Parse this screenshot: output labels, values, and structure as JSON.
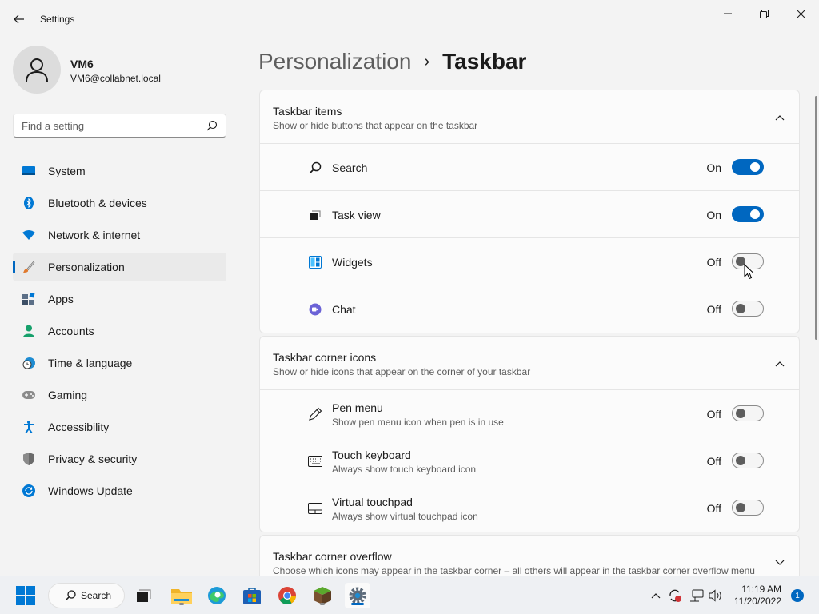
{
  "window": {
    "title": "Settings"
  },
  "profile": {
    "name": "VM6",
    "email": "VM6@collabnet.local"
  },
  "search": {
    "placeholder": "Find a setting"
  },
  "sidebar": {
    "items": [
      {
        "label": "System",
        "icon": "system-icon",
        "active": false
      },
      {
        "label": "Bluetooth & devices",
        "icon": "bluetooth-icon",
        "active": false
      },
      {
        "label": "Network & internet",
        "icon": "wifi-icon",
        "active": false
      },
      {
        "label": "Personalization",
        "icon": "brush-icon",
        "active": true
      },
      {
        "label": "Apps",
        "icon": "apps-icon",
        "active": false
      },
      {
        "label": "Accounts",
        "icon": "accounts-icon",
        "active": false
      },
      {
        "label": "Time & language",
        "icon": "clock-globe-icon",
        "active": false
      },
      {
        "label": "Gaming",
        "icon": "gamepad-icon",
        "active": false
      },
      {
        "label": "Accessibility",
        "icon": "accessibility-icon",
        "active": false
      },
      {
        "label": "Privacy & security",
        "icon": "shield-icon",
        "active": false
      },
      {
        "label": "Windows Update",
        "icon": "update-icon",
        "active": false
      }
    ]
  },
  "breadcrumb": {
    "parent": "Personalization",
    "separator": "›",
    "current": "Taskbar"
  },
  "sections": {
    "items": {
      "title": "Taskbar items",
      "subtitle": "Show or hide buttons that appear on the taskbar",
      "rows": [
        {
          "label": "Search",
          "state": "On",
          "on": true,
          "icon": "search-icon"
        },
        {
          "label": "Task view",
          "state": "On",
          "on": true,
          "icon": "task-view-icon"
        },
        {
          "label": "Widgets",
          "state": "Off",
          "on": false,
          "icon": "widgets-icon"
        },
        {
          "label": "Chat",
          "state": "Off",
          "on": false,
          "icon": "chat-icon"
        }
      ]
    },
    "corner": {
      "title": "Taskbar corner icons",
      "subtitle": "Show or hide icons that appear on the corner of your taskbar",
      "rows": [
        {
          "label": "Pen menu",
          "desc": "Show pen menu icon when pen is in use",
          "state": "Off",
          "on": false,
          "icon": "pen-icon"
        },
        {
          "label": "Touch keyboard",
          "desc": "Always show touch keyboard icon",
          "state": "Off",
          "on": false,
          "icon": "keyboard-icon"
        },
        {
          "label": "Virtual touchpad",
          "desc": "Always show virtual touchpad icon",
          "state": "Off",
          "on": false,
          "icon": "touchpad-icon"
        }
      ]
    },
    "overflow": {
      "title": "Taskbar corner overflow",
      "subtitle": "Choose which icons may appear in the taskbar corner – all others will appear in the taskbar corner overflow menu"
    }
  },
  "taskbar": {
    "search_label": "Search",
    "time": "11:19 AM",
    "date": "11/20/2022",
    "notification_count": "1"
  },
  "colors": {
    "accent": "#0067c0",
    "background": "#f3f3f3",
    "card": "#fbfbfb"
  }
}
